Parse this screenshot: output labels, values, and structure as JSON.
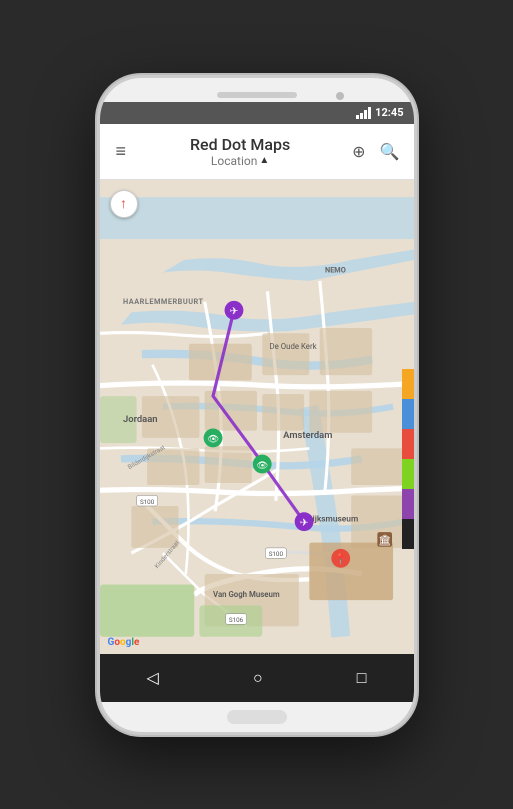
{
  "phone": {
    "speaker_label": "speaker",
    "camera_label": "camera"
  },
  "status_bar": {
    "time": "12:45",
    "wifi_signal": "signal"
  },
  "app_bar": {
    "menu_icon": "≡",
    "title": "Red Dot Maps",
    "subtitle": "Location",
    "nav_arrow": "▲",
    "location_icon": "⊕",
    "search_icon": "🔍"
  },
  "map": {
    "compass_symbol": "↑",
    "neighborhood_haarlemmerbuurt": "HAARLEMMERBUURT",
    "neighborhood_jordaan": "Jordaan",
    "neighborhood_amsterdam": "Amsterdam",
    "neighborhood_rijksmuseum": "Rijksmuseum",
    "neighborhood_vangogmuseum": "Van Gogh Museum",
    "road_s100a": "S100",
    "road_s100b": "S100",
    "road_s106": "S106",
    "road_kinderstraat": "Kinderstraat",
    "road_bilderdijkstraat": "Bilderdijkstraat",
    "area_oudeKerk": "De Oude Kerk",
    "area_nemo": "NEMO",
    "google_logo": "Google"
  },
  "legend": {
    "colors": [
      "#F5A623",
      "#4A90D9",
      "#E74C3C",
      "#7ED321",
      "#8E44AD",
      "#222222"
    ],
    "labels": [
      "orange",
      "blue",
      "red",
      "green",
      "purple",
      "black"
    ]
  },
  "nav_bar": {
    "back_icon": "◁",
    "home_icon": "○",
    "recent_icon": "□"
  }
}
